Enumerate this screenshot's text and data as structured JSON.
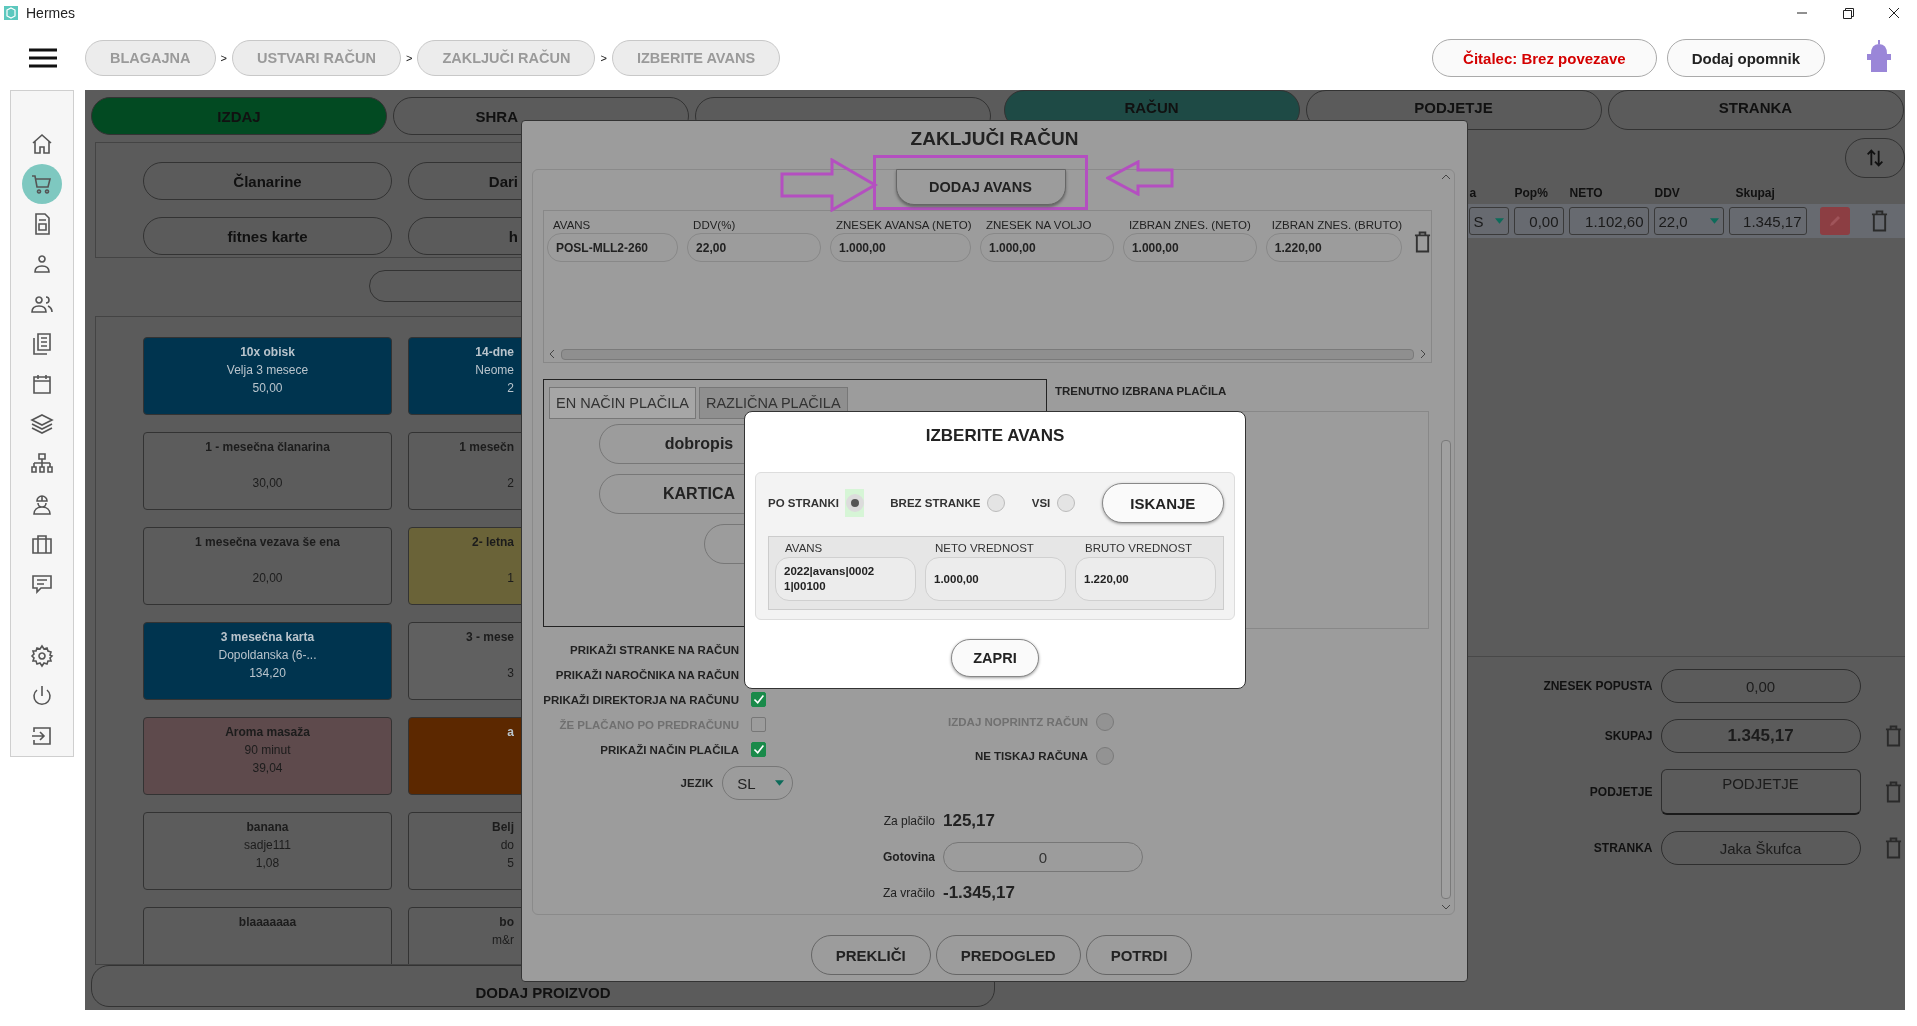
{
  "window": {
    "title": "Hermes"
  },
  "top_bar": {
    "breadcrumbs": [
      {
        "label": "BLAGAJNA",
        "separator": ">"
      },
      {
        "label": "USTVARI RAČUN",
        "separator": ">"
      },
      {
        "label": "ZAKLJUČI RAČUN",
        "separator": ">"
      },
      {
        "label": "IZBERITE AVANS"
      }
    ],
    "reader_status": "Čitalec: Brez povezave",
    "reminder_button": "Dodaj opomnik"
  },
  "sidebar": {
    "items": [
      {
        "kind": "home",
        "selected": false
      },
      {
        "kind": "cart",
        "selected": true
      },
      {
        "kind": "document",
        "selected": false
      },
      {
        "kind": "person",
        "selected": false
      },
      {
        "kind": "people",
        "selected": false
      },
      {
        "kind": "documents",
        "selected": false
      },
      {
        "kind": "calendar",
        "selected": false
      },
      {
        "kind": "layers",
        "selected": false
      },
      {
        "kind": "network",
        "selected": false
      },
      {
        "kind": "worker",
        "selected": false
      },
      {
        "kind": "briefcase",
        "selected": false
      },
      {
        "kind": "chat",
        "selected": false
      }
    ],
    "footer_items": [
      {
        "kind": "settings",
        "selected": false
      },
      {
        "kind": "power",
        "selected": false
      },
      {
        "kind": "exit",
        "selected": false
      }
    ]
  },
  "sale_panel": {
    "tabs": [
      {
        "label": "IZDAJ",
        "selected": true
      },
      {
        "label": "SHRA",
        "selected": false
      },
      {
        "selected": false
      }
    ],
    "categories": [
      "Članarine",
      "Dari",
      "fitnes karte",
      "h"
    ],
    "products": [
      {
        "name": "10x obisk",
        "note": "Velja 3 mesece",
        "price": "50,00",
        "color": "#00344f"
      },
      {
        "name": "14-dne",
        "note": "Neome",
        "price": "2",
        "color": "#00344f"
      },
      {
        "name": "1 - mesečna članarina",
        "price": "30,00",
        "color": "#5c5c5c"
      },
      {
        "name": "1 mesečn",
        "price": "2",
        "color": "#5c5c5c"
      },
      {
        "name": "1 mesečna vezava še ena",
        "price": "20,00",
        "color": "#5c5c5c"
      },
      {
        "name": "2- letna",
        "price": "1",
        "color": "#6a6338"
      },
      {
        "name": "3 mesečna karta",
        "note": "Dopoldanska (6-...",
        "price": "134,20",
        "color": "#00344f"
      },
      {
        "name": "3 - mese",
        "price": "3",
        "color": "#606060"
      },
      {
        "name": "Aroma masaža",
        "note": "90 minut",
        "price": "39,04",
        "color": "#5e4a4c"
      },
      {
        "name": "a",
        "color": "#5c2800"
      },
      {
        "name": "banana",
        "note": "sadje111",
        "price": "1,08",
        "color": "#5c5c5c"
      },
      {
        "name": "Belj",
        "note": "do",
        "price": "5",
        "color": "#5c5c5c"
      },
      {
        "name": "blaaaaaaa",
        "color": "#5c5c5c"
      },
      {
        "name": "bo",
        "note": "m&r",
        "color": "#5c5c5c"
      }
    ],
    "add_product_button": "DODAJ PROIZVOD"
  },
  "invoice_panel": {
    "tabs": [
      {
        "label": "RAČUN",
        "selected": true
      },
      {
        "label": "PODJETJE",
        "selected": false
      },
      {
        "label": "STRANKA",
        "selected": false
      }
    ],
    "columns": [
      "a",
      "Pop%",
      "NETO",
      "DDV",
      "Skupaj"
    ],
    "row": {
      "unit": "S",
      "discount": "0,00",
      "net": "1.102,60",
      "vat": "22,0",
      "total": "1.345,17"
    },
    "summary": [
      {
        "label": "ZNESEK POPUSTA",
        "value": "0,00",
        "kind": "amount",
        "deletable": false
      },
      {
        "label": "SKUPAJ",
        "value": "1.345,17",
        "kind": "total",
        "deletable": true
      },
      {
        "label": "PODJETJE",
        "value": "PODJETJE",
        "kind": "picker",
        "deletable": true
      },
      {
        "label": "STRANKA",
        "value": "Jaka Škufca",
        "kind": "amount",
        "deletable": true
      }
    ]
  },
  "close_invoice_dialog": {
    "title": "ZAKLJUČI RAČUN",
    "add_advance_button": "DODAJ AVANS",
    "advance_columns": [
      {
        "label": "AVANS",
        "value": "POSL-MLL2-260"
      },
      {
        "label": "DDV(%)",
        "value": "22,00"
      },
      {
        "label": "ZNESEK AVANSA (NETO)",
        "value": "1.000,00"
      },
      {
        "label": "ZNESEK NA VOLJO",
        "value": "1.000,00"
      },
      {
        "label": "IZBRAN ZNES. (NETO)",
        "value": "1.000,00"
      },
      {
        "label": "IZBRAN ZNES. (BRUTO)",
        "value": "1.220,00"
      }
    ],
    "payment_tabs": [
      {
        "label": "EN NAČIN PLAČILA",
        "selected": true
      },
      {
        "label": "RAZLIČNA PLAČILA",
        "selected": false
      }
    ],
    "payment_methods": [
      "dobropis",
      "KARTICA"
    ],
    "selected_payments_label": "TRENUTNO IZBRANA PLAČILA",
    "options": [
      {
        "label": "PRIKAŽI STRANKE NA RAČUN",
        "disabled": false
      },
      {
        "label": "PRIKAŽI NAROČNIKA NA RAČUN",
        "disabled": false
      },
      {
        "label": "PRIKAŽI DIREKTORJA NA RAČUNU",
        "checked": true,
        "disabled": false
      },
      {
        "label": "ŽE PLAČANO PO PREDRAČUNU",
        "checked": false,
        "disabled": true
      },
      {
        "label": "PRIKAŽI NAČIN PLAČILA",
        "checked": true,
        "disabled": false
      }
    ],
    "language": {
      "label": "JEZIK",
      "value": "SL"
    },
    "print_options": [
      {
        "label": "IZDAJ NOPRINTZ RAČUN",
        "selected": false,
        "disabled": true
      },
      {
        "label": "NE TISKAJ RAČUNA",
        "selected": false,
        "disabled": false
      }
    ],
    "totals": {
      "to_pay_label": "Za plačilo",
      "to_pay": "125,17",
      "cash_label": "Gotovina",
      "cash": "0",
      "change_label": "Za vračilo",
      "change": "-1.345,17"
    },
    "buttons": [
      "PREKLIČI",
      "PREDOGLED",
      "POTRDI"
    ]
  },
  "select_advance_dialog": {
    "title": "IZBERITE AVANS",
    "filters": [
      {
        "label": "PO STRANKI",
        "selected": true
      },
      {
        "label": "BREZ STRANKE",
        "selected": false
      },
      {
        "label": "VSI",
        "selected": false
      }
    ],
    "search_button": "ISKANJE",
    "columns": [
      {
        "label": "AVANS",
        "value": "2022|avans|00021|00100"
      },
      {
        "label": "NETO VREDNOST",
        "value": "1.000,00"
      },
      {
        "label": "BRUTO VREDNOST",
        "value": "1.220,00"
      }
    ],
    "close_button": "ZAPRI"
  }
}
